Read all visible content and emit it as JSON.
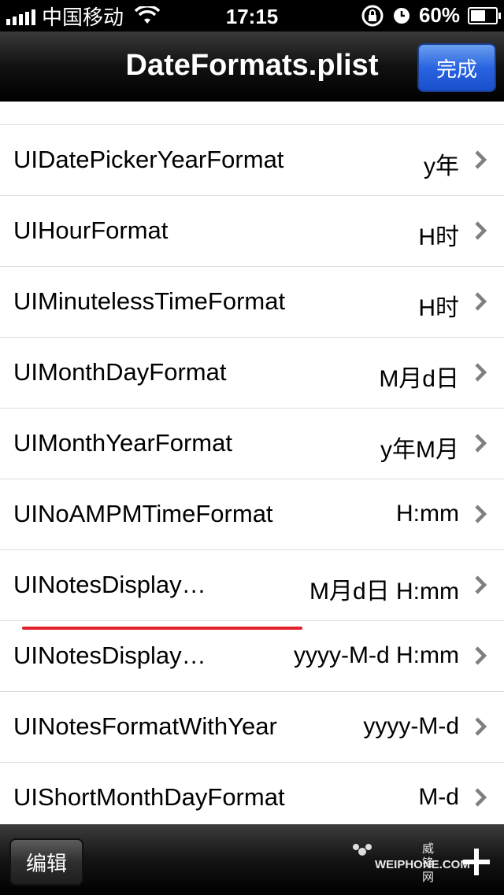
{
  "status_bar": {
    "carrier": "中国移动",
    "time": "17:15",
    "battery_percent": "60%",
    "battery_level": 0.6,
    "icons": [
      "signal-icon",
      "wifi-icon",
      "rotation-lock-icon",
      "alarm-icon",
      "battery-icon"
    ]
  },
  "nav": {
    "title": "DateFormats.plist",
    "done_label": "完成"
  },
  "rows": [
    {
      "key": "",
      "value": ""
    },
    {
      "key": "UIDatePickerYearFormat",
      "value": "y年"
    },
    {
      "key": "UIHourFormat",
      "value": "H时"
    },
    {
      "key": "UIMinutelessTimeFormat",
      "value": "H时"
    },
    {
      "key": "UIMonthDayFormat",
      "value": "M月d日"
    },
    {
      "key": "UIMonthYearFormat",
      "value": "y年M月"
    },
    {
      "key": "UINoAMPMTimeFormat",
      "value": "H:mm"
    },
    {
      "key": "UINotesDisplay…",
      "value": "M月d日   H:mm"
    },
    {
      "key": "UINotesDisplay…",
      "value": "yyyy-M-d   H:mm"
    },
    {
      "key": "UINotesFormatWithYear",
      "value": "yyyy-M-d"
    },
    {
      "key": "UIShortMonthDayFormat",
      "value": "M-d"
    }
  ],
  "toolbar": {
    "edit_label": "编辑",
    "watermark_cn": "威锋网",
    "watermark_en": "WEIPHONE.COM"
  },
  "colors": {
    "accent_blue": "#2a64e0",
    "highlight_underline": "#e0202a"
  }
}
